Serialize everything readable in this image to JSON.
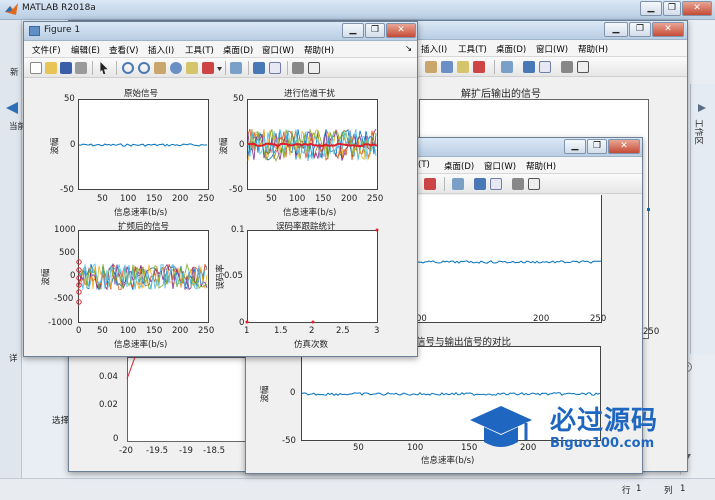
{
  "main": {
    "title": "MATLAB R2018a",
    "left_labels": {
      "tab_new": "新",
      "current": "当前",
      "detail": "详",
      "select": "选择"
    },
    "status": {
      "row_label": "行",
      "row_value": "1",
      "col_label": "列",
      "col_value": "1"
    },
    "side_tab": "工作区"
  },
  "figure1": {
    "title": "Figure 1",
    "menu": [
      "文件(F)",
      "编辑(E)",
      "查看(V)",
      "插入(I)",
      "工具(T)",
      "桌面(D)",
      "窗口(W)",
      "帮助(H)"
    ],
    "subplots": [
      {
        "title": "原始信号",
        "xlabel": "信息速率(b/s)",
        "ylabel": "波幅",
        "yticks": [
          "50",
          "0",
          "-50"
        ],
        "xticks": [
          "50",
          "100",
          "150",
          "200",
          "250"
        ]
      },
      {
        "title": "进行信道干扰",
        "xlabel": "信息速率(b/s)",
        "ylabel": "波幅",
        "yticks": [
          "50",
          "0",
          "-50"
        ],
        "xticks": [
          "50",
          "100",
          "150",
          "200",
          "250"
        ]
      },
      {
        "title": "扩频后的信号",
        "xlabel": "信息速率(b/s)",
        "ylabel": "波幅",
        "yticks": [
          "1000",
          "500",
          "0",
          "-500",
          "-1000"
        ],
        "xticks": [
          "0",
          "50",
          "100",
          "150",
          "200",
          "250"
        ]
      },
      {
        "title": "误码率跟踪统计",
        "xlabel": "仿真次数",
        "ylabel": "误码率",
        "yticks": [
          "0.1",
          "0.05",
          "0"
        ],
        "xticks": [
          "1",
          "1.5",
          "2",
          "2.5",
          "3"
        ]
      }
    ]
  },
  "figure_back": {
    "menu": [
      "插入(I)",
      "工具(T)",
      "桌面(D)",
      "窗口(W)",
      "帮助(H)"
    ],
    "title_text": "解扩后输出的信号",
    "ytick": "0.02",
    "bottom": {
      "yticks": [
        "0.04",
        "0.02",
        "0"
      ],
      "xticks": [
        "-20",
        "-19.5",
        "-19",
        "-18.5"
      ]
    }
  },
  "figure3": {
    "menu": [
      "(T)",
      "桌面(D)",
      "窗口(W)",
      "帮助(H)"
    ],
    "top_xticks": [
      "200",
      "250"
    ],
    "top_xtick_first": "00",
    "bottom_title": "信号与输出信号的对比",
    "bottom_yticks": [
      "0",
      "-50"
    ],
    "bottom_ylabel": "波幅",
    "bottom_xticks": [
      "50",
      "100",
      "150",
      "200"
    ],
    "bottom_xlabel": "信息速率(b/s)",
    "right_tick": "250"
  },
  "watermark": {
    "cn": "必过源码",
    "url": "Biguo100.com"
  },
  "colors": {
    "series_blue": "#0072bd",
    "series_orange": "#d95319",
    "series_yellow": "#edb120",
    "series_purple": "#7e2f8e",
    "series_green": "#77ac30",
    "series_cyan": "#4dbeee",
    "marker_red": "#e0202a"
  }
}
